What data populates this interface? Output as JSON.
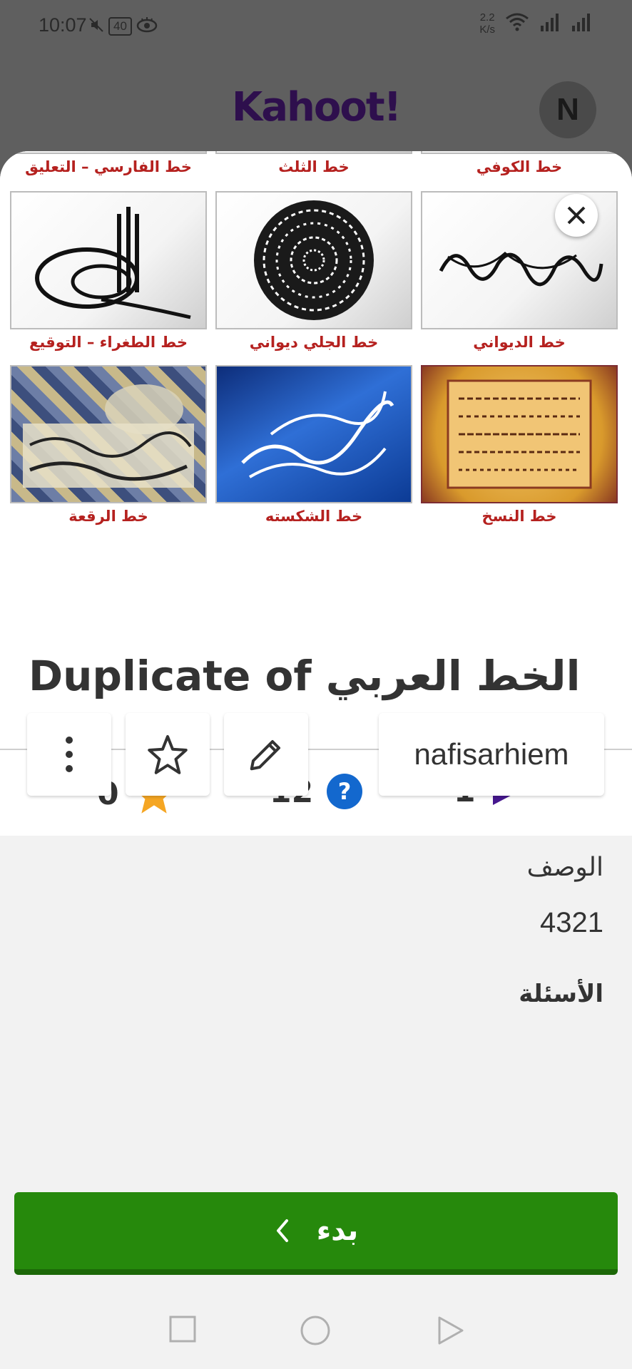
{
  "status_bar": {
    "time": "10:07",
    "battery": "40",
    "speed_value": "2.2",
    "speed_unit": "K/s"
  },
  "header": {
    "logo": "Kahoot!",
    "avatar_initial": "N"
  },
  "cover": {
    "captions": [
      "خط الفارسي – التعليق",
      "خط الثلث",
      "خط الكوفي",
      "خط الطغراء – التوقيع",
      "خط الجلي ديواني",
      "خط الديواني",
      "خط الرقعة",
      "خط الشكسته",
      "خط النسخ"
    ]
  },
  "kahoot": {
    "title": "Duplicate of الخط العربي",
    "favorites": "0",
    "questions_count": "12",
    "plays": "1",
    "author": "nafisarhiem",
    "description_label": "الوصف",
    "description": "4321",
    "questions_label": "الأسئلة"
  },
  "start_button": {
    "label": "بدء"
  },
  "colors": {
    "primary_green": "#26890c",
    "star": "#f5a623",
    "question_blue": "#1368ce",
    "play_purple": "#46178f",
    "caption_red": "#b5211f"
  }
}
